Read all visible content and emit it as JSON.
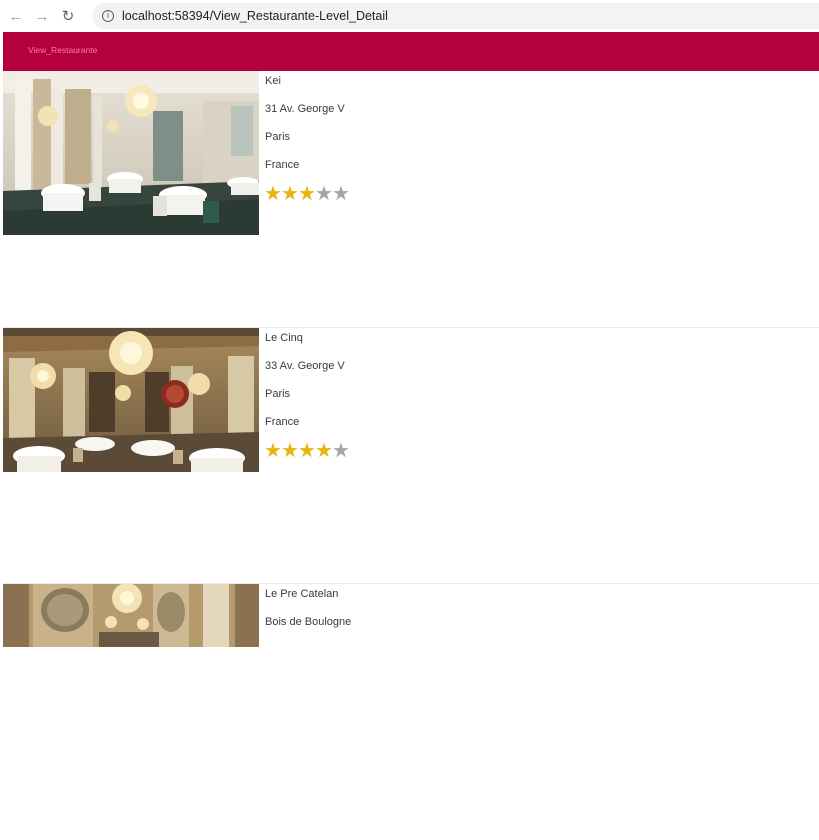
{
  "browser": {
    "url": "localhost:58394/View_Restaurante-Level_Detail",
    "back_icon": "arrow-left-icon",
    "forward_icon": "arrow-right-icon",
    "reload_icon": "reload-icon",
    "info_icon": "info-icon"
  },
  "navbar": {
    "brand": "View_Restaurante",
    "color": "#b5003f",
    "brand_color": "#ff7aa8"
  },
  "star_colors": {
    "filled": "#e8b40f",
    "empty": "#a6a6a6"
  },
  "restaurants": [
    {
      "name": "Kei",
      "address": "31 Av. George V",
      "city": "Paris",
      "country": "France",
      "rating": 3,
      "max_rating": 5
    },
    {
      "name": "Le Cinq",
      "address": "33 Av. George V",
      "city": "Paris",
      "country": "France",
      "rating": 4,
      "max_rating": 5
    },
    {
      "name": "Le Pre Catelan",
      "address": "Bois de Boulogne"
    }
  ]
}
